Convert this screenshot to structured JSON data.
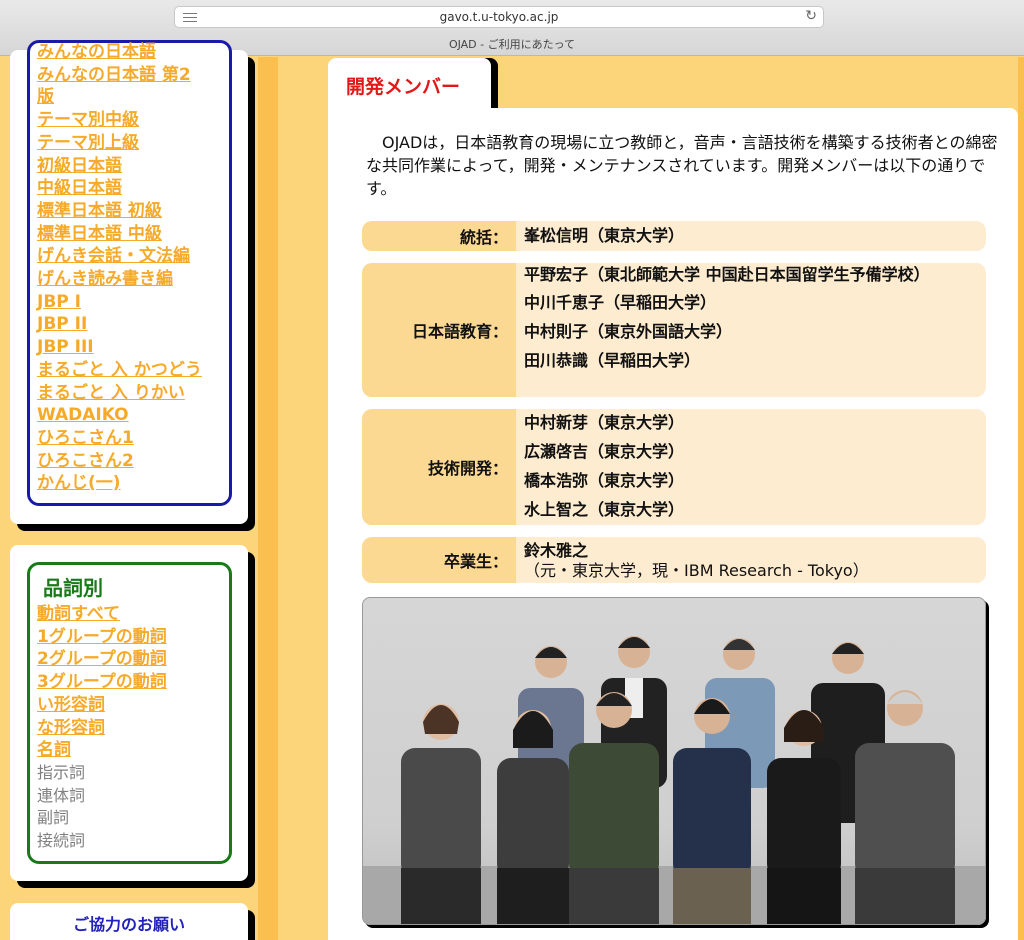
{
  "browser": {
    "url": "gavo.t.u-tokyo.ac.jp",
    "tab_title": "OJAD - ご利用にあたって"
  },
  "sidebar": {
    "textbook_links": [
      "みんなの日本語",
      "みんなの日本語 第2",
      "版",
      "テーマ別中級",
      "テーマ別上級",
      "初級日本語",
      "中級日本語",
      "標準日本語 初級",
      "標準日本語 中級",
      "げんき会話・文法編",
      "げんき読み書き編",
      "JBP I",
      "JBP II",
      "JBP III",
      "まるごと 入 かつどう",
      "まるごと 入 りかい",
      "WADAIKO",
      "ひろこさん1",
      "ひろこさん2",
      "かんじ(一)"
    ],
    "pos_heading": "品詞別",
    "pos_links": [
      "動詞すべて",
      "1グループの動詞",
      "2グループの動詞",
      "3グループの動詞",
      "い形容詞",
      "な形容詞",
      "名詞"
    ],
    "pos_inactive": [
      "指示詞",
      "連体詞",
      "副詞",
      "接続詞"
    ],
    "cooperation": "ご協力のお願い"
  },
  "main": {
    "tab_label": "開発メンバー",
    "intro": "OJADは，日本語教育の現場に立つ教師と，音声・言語技術を構築する技術者との綿密な共同作業によって，開発・メンテナンスされています。開発メンバーは以下の通りです。",
    "members": [
      {
        "label": "統括：",
        "people": [
          "峯松信明（東京大学）"
        ]
      },
      {
        "label": "日本語教育：",
        "people": [
          "平野宏子（東北師範大学 中国赴日本国留学生予備学校）",
          "中川千恵子（早稲田大学）",
          "中村則子（東京外国語大学）",
          "田川恭識（早稲田大学）"
        ]
      },
      {
        "label": "技術開発：",
        "people": [
          "中村新芽（東京大学）",
          "広瀬啓吉（東京大学）",
          "橋本浩弥（東京大学）",
          "水上智之（東京大学）"
        ]
      },
      {
        "label": "卒業生：",
        "people": [
          "鈴木雅之",
          "（元・東京大学，現・IBM Research - Tokyo）"
        ]
      }
    ]
  }
}
